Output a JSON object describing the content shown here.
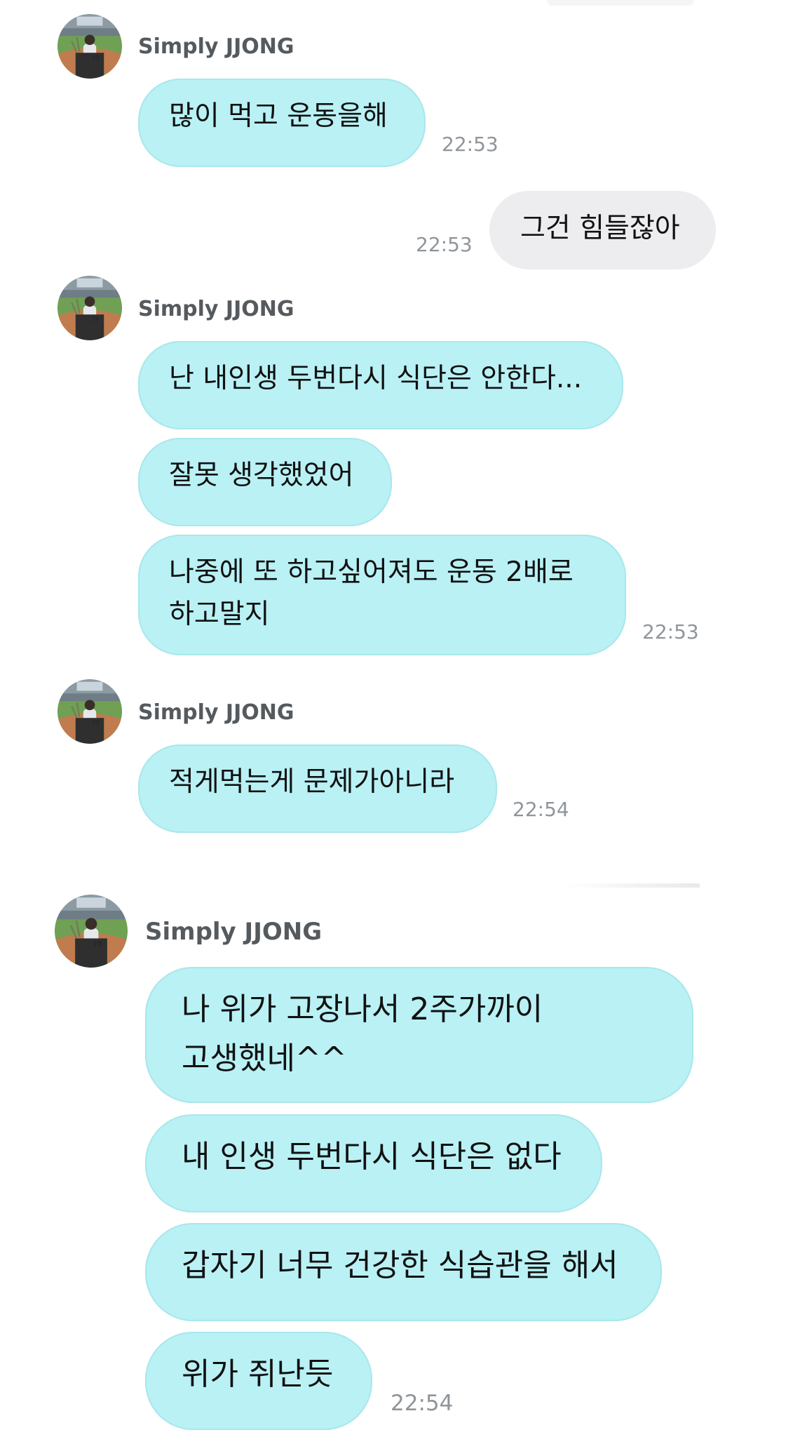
{
  "messages": [
    {
      "sender": "Simply JJONG",
      "text": "많이 먹고 운동을해",
      "time": "22:53"
    },
    {
      "text": "그건 힘들잖아",
      "time": "22:53"
    },
    {
      "sender": "Simply JJONG",
      "lines": [
        "난 내인생 두번다시 식단은 안한다...",
        "잘못 생각했었어",
        "나중에 또 하고싶어져도 운동 2배로\n하고말지"
      ],
      "time": "22:53"
    },
    {
      "sender": "Simply JJONG",
      "text": "적게먹는게 문제가아니라",
      "time": "22:54"
    },
    {
      "sender": "Simply JJONG",
      "lines": [
        "나 위가 고장나서 2주가까이\n고생했네^^",
        "내 인생 두번다시 식단은 없다",
        "갑자기 너무 건강한 식습관을 해서",
        "위가 쥐난듯"
      ],
      "time": "22:54"
    }
  ],
  "colors": {
    "incoming_bubble": "#b9f1f5",
    "outgoing_bubble": "#ededf0",
    "timestamp": "#8f959a",
    "sender_name": "#555a5e"
  },
  "icons": {
    "avatar": "profile-photo-baseball-stadium"
  }
}
